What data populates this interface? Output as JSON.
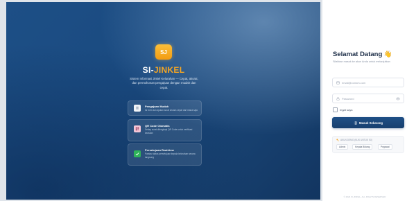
{
  "hero": {
    "logo_text": "SJ",
    "brand_prefix": "SI-",
    "brand_accent": "JINKEL",
    "tagline": "Sistem Informasi Jinkel Kelurahan — Cepat, akurat, dan permohonan pengajuan dengan mudah dan cepat.",
    "features": [
      {
        "title": "Pengajuan Mudah",
        "description": "Isi form dan ajukan surat secara cepat dari mana saja",
        "icon": "document-icon"
      },
      {
        "title": "QR Code Otomatis",
        "description": "Setiap surat dilengkapi QR Code untuk verifikasi keaslian",
        "icon": "qr-code-icon"
      },
      {
        "title": "Persetujuan Real-time",
        "description": "Pantau status persetujuan kepala kelurahan secara langsung",
        "icon": "check-icon"
      }
    ]
  },
  "login": {
    "welcome": "Selamat Datang",
    "welcome_emoji": "👋",
    "subtitle": "Silahkan masuk ke akun Anda untuk melanjutkan",
    "email_placeholder": "email@contoh.com",
    "password_placeholder": "Password",
    "remember_label": "Ingat saya",
    "submit_label": "Masuk Sekarang",
    "demo_title": "AKUN DEMO (KLIK UNTUK ISI)",
    "demo_accounts": [
      "Admin",
      "Kepala Bidang",
      "Pegawai"
    ],
    "footer": "© 2024 SI-JINKEL. ALL RIGHTS RESERVED"
  },
  "colors": {
    "hero_bg": "#1a4a80",
    "accent": "#f5a623",
    "primary_button": "#17406f"
  }
}
